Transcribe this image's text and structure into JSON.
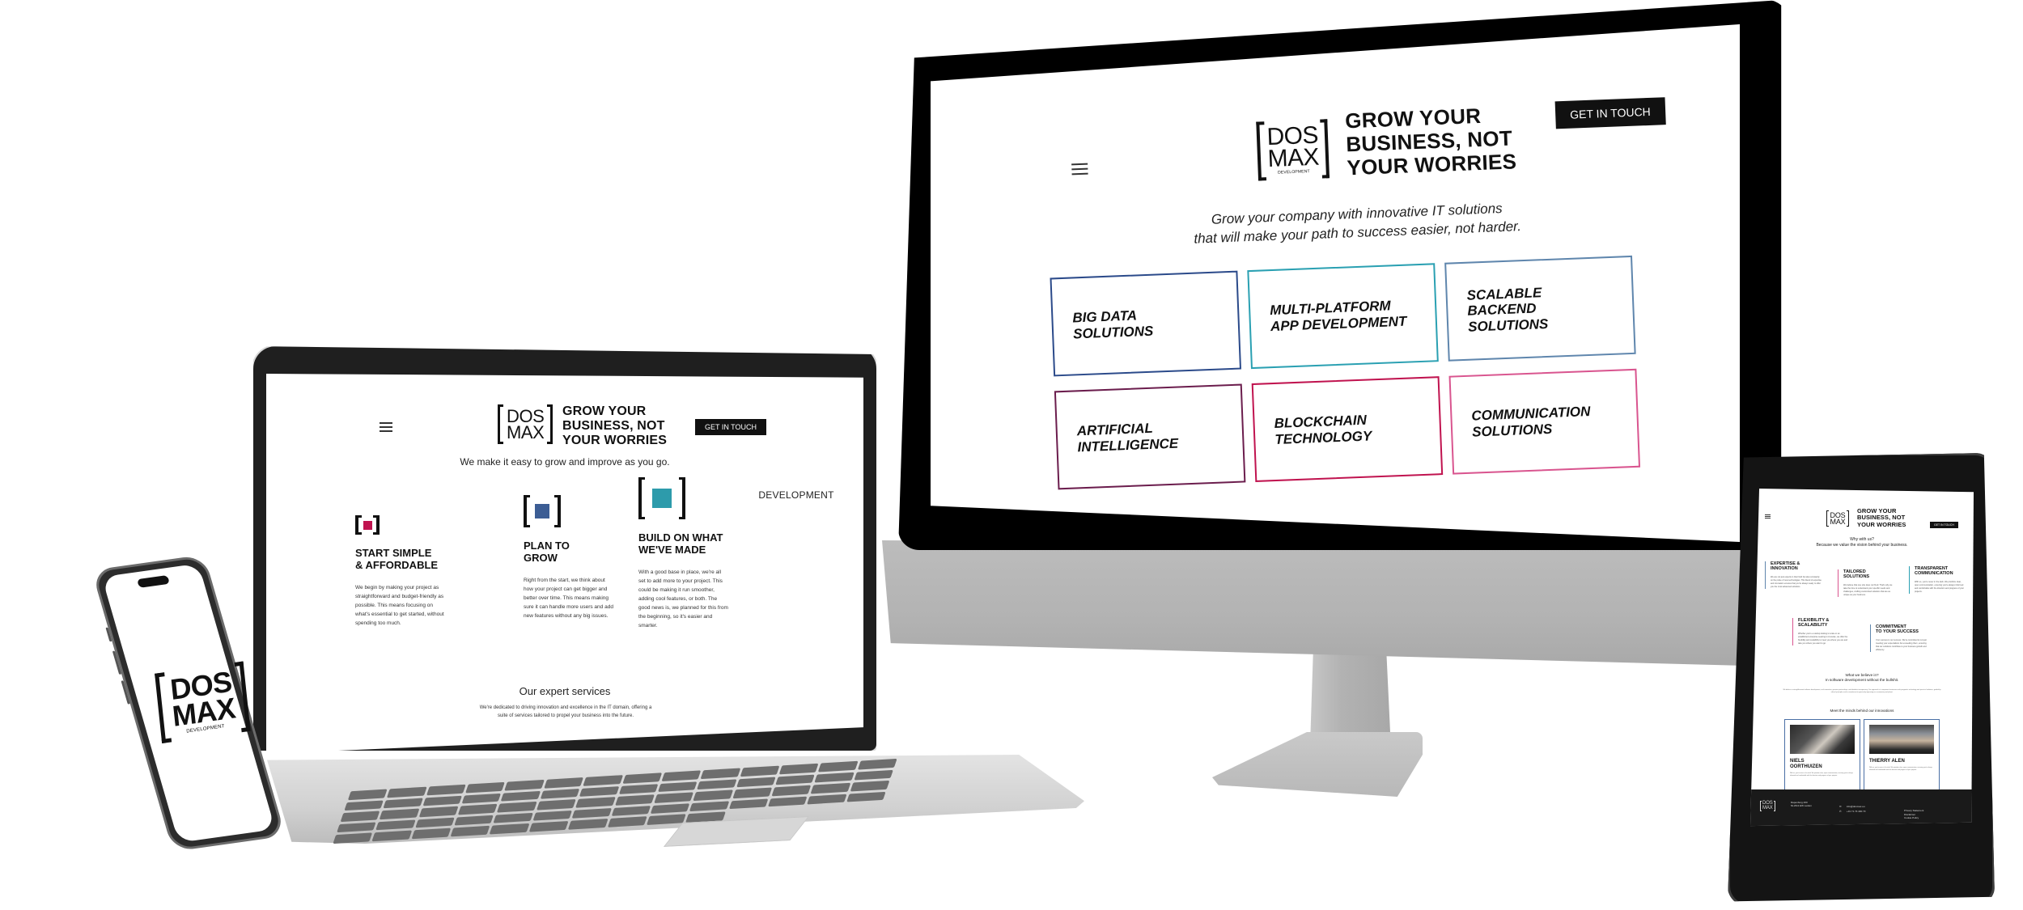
{
  "brand": {
    "logo_line1": "DOS",
    "logo_line2": "MAX",
    "logo_sub": "DEVELOPMENT",
    "headline_lines": [
      "GROW YOUR",
      "BUSINESS, NOT",
      "YOUR WORRIES"
    ],
    "cta_label": "GET IN TOUCH",
    "colors": {
      "navy": "#2b4a8a",
      "teal": "#2aa0b2",
      "steel": "#5f86ad",
      "plum": "#6b1d4d",
      "crimson": "#c0134f",
      "pink": "#d9558f",
      "dark": "#111111"
    }
  },
  "monitor": {
    "menu_icon": "hamburger-icon",
    "tagline_lines": [
      "Grow your company with innovative IT solutions",
      "that will make your path to success easier, not harder."
    ],
    "services": [
      {
        "lines": [
          "BIG DATA",
          "SOLUTIONS"
        ],
        "color": "#2b4a8a"
      },
      {
        "lines": [
          "MULTI-PLATFORM",
          "APP DEVELOPMENT"
        ],
        "color": "#2aa0b2"
      },
      {
        "lines": [
          "SCALABLE",
          "BACKEND",
          "SOLUTIONS"
        ],
        "color": "#5f86ad"
      },
      {
        "lines": [
          "ARTIFICIAL",
          "INTELLIGENCE"
        ],
        "color": "#6b1d4d"
      },
      {
        "lines": [
          "BLOCKCHAIN",
          "TECHNOLOGY"
        ],
        "color": "#c0134f"
      },
      {
        "lines": [
          "COMMUNICATION",
          "SOLUTIONS"
        ],
        "color": "#d9558f"
      }
    ]
  },
  "laptop": {
    "menu_icon": "hamburger-icon",
    "subtitle": "We make it easy to grow and improve as you go.",
    "features": [
      {
        "title_lines": [
          "START SIMPLE",
          "& AFFORDABLE"
        ],
        "accent": "#c0134f",
        "body": "We begin by making your project as straightforward and budget-friendly as possible. This means focusing on what's essential to get started, without spending too much."
      },
      {
        "title_lines": [
          "PLAN TO",
          "GROW"
        ],
        "accent": "#3c5d94",
        "body": "Right from the start, we think about how your project can get bigger and better over time. This means making sure it can handle more users and add new features without any big issues."
      },
      {
        "title_lines": [
          "BUILD ON WHAT",
          "WE'VE MADE"
        ],
        "accent": "#2d9bab",
        "body": "With a good base in place, we're all set to add more to your project. This could be making it run smoother, adding cool features, or both. The good news is, we planned for this from the beginning, so it's easier and smarter."
      }
    ],
    "services_title": "Our expert services",
    "services_desc": "We're dedicated to driving innovation and excellence in the IT domain, offering a suite of services tailored to propel your business into the future."
  },
  "phone": {
    "logo_line1": "DOS",
    "logo_line2": "MAX",
    "logo_sub": "DEVELOPMENT"
  },
  "tablet": {
    "why_lines": [
      "Why with us?",
      "Because we value the vision behind your business."
    ],
    "pillars": [
      {
        "title_lines": [
          "EXPERTISE &",
          "INNOVATION"
        ],
        "color": "#5f86ad",
        "body": "We are not just experts in their field but also constantly on the pulse of new technologies. This blend of expertise and innovation ensures that you're always ready to offer you the most advanced solutions."
      },
      {
        "title_lines": [
          "TAILORED",
          "SOLUTIONS"
        ],
        "color": "#d9558f",
        "body": "We believe that one size does not fit all. That's why we take the time to understand your specific needs and challenges, crafting customized solutions that are as unique as your business."
      },
      {
        "title_lines": [
          "TRANSPARENT",
          "COMMUNICATION"
        ],
        "color": "#2aa0b2",
        "body": "With us, you're never in the dark. We prioritize clear, open communication, ensuring you're always informed and comfortable with the direction and progress of your projects."
      },
      {
        "title_lines": [
          "FLEXIBILITY &",
          "SCALABILITY"
        ],
        "color": "#d9558f",
        "body": "Whether you're a startup looking to scale or an established enterprise seeking to innovate, we offer the flexibility and scalability to meet you where you are and take you where you want to go."
      },
      {
        "title_lines": [
          "COMMITMENT",
          "TO YOUR SUCCESS"
        ],
        "color": "#5f86ad",
        "body": "Your success is our success. We're committed to not just meeting your expectations but exceeding them, ensuring that our solutions contribute to your business growth and efficiency."
      }
    ],
    "believe_lines": [
      "What we believe in?",
      "In software development without the bullshit."
    ],
    "believe_body": "We believe in straightforward software development, real innovation, genuine partnerships, and absolute transparency. Our approach is to empower businesses with pragmatic technology and practical solutions, guided by ethical principles and a commitment to genuinely improving our community and planet.",
    "minds_title": "Meet the minds behind our innovations",
    "people": [
      {
        "name_lines": [
          "NIELS",
          "OORTHUIZEN"
        ],
        "bio": "With us, you're never in the dark. We prioritize clear, open communication, ensuring you're always informed and comfortable with the direction and progress of your projects."
      },
      {
        "name_lines": [
          "THIERRY ALEN"
        ],
        "bio": "With us, you're never in the dark. We prioritize clear, open communication, ensuring you're always informed and comfortable with the direction and progress of your projects."
      }
    ],
    "cta_label": "GET IN TOUCH",
    "footer": {
      "address_lines": [
        "Rapenburg 200",
        "NL2311 EW Leiden"
      ],
      "email": "info@dosmax.eu",
      "phone": "+31 71 74 400 73",
      "email_icon": "mail-icon",
      "phone_icon": "phone-icon",
      "links": [
        "Privacy Statement",
        "Disclaimer",
        "Cookie Policy"
      ]
    }
  }
}
